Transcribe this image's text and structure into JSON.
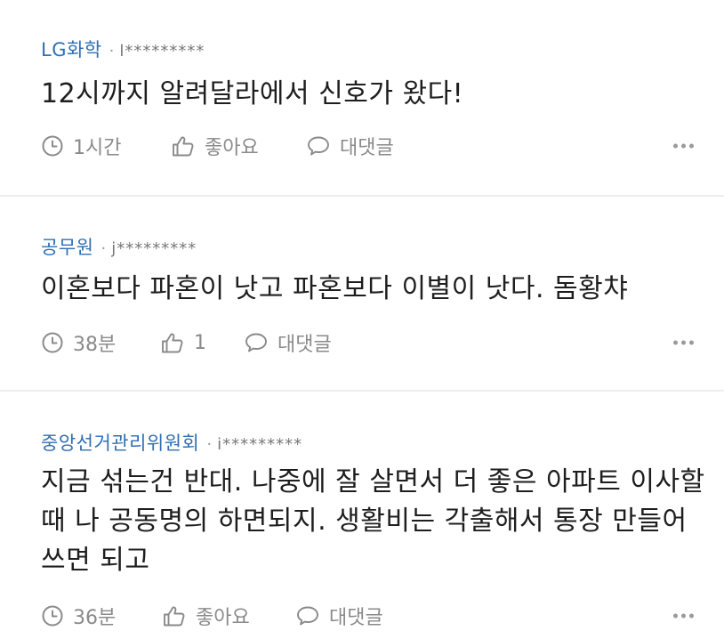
{
  "comments": [
    {
      "author": "LG화학",
      "separator": "·",
      "user_id": "l*********",
      "text": "12시까지 알려달라에서 신호가 왔다!",
      "time": "1시간",
      "like_label": "좋아요",
      "reply_label": "대댓글"
    },
    {
      "author": "공무원",
      "separator": "·",
      "user_id": "j*********",
      "text": "이혼보다 파혼이 낫고 파혼보다 이별이 낫다. 돔황챠",
      "time": "38분",
      "like_label": "1",
      "reply_label": "대댓글"
    },
    {
      "author": "중앙선거관리위원회",
      "separator": "·",
      "user_id": "i*********",
      "text": "지금 섞는건 반대. 나중에 잘 살면서 더 좋은 아파트 이사할때 나 공동명의 하면되지. 생활비는 각출해서 통장 만들어 쓰면 되고",
      "time": "36분",
      "like_label": "좋아요",
      "reply_label": "대댓글"
    }
  ],
  "icons": {
    "time": "clock-icon",
    "like": "thumbs-up-icon",
    "reply": "speech-bubble-icon",
    "more": "more-dots-icon"
  },
  "colors": {
    "author": "#2f6fb2",
    "body_text": "#1e1e1e",
    "muted": "#8a8a8a",
    "divider": "#eeeeee"
  }
}
